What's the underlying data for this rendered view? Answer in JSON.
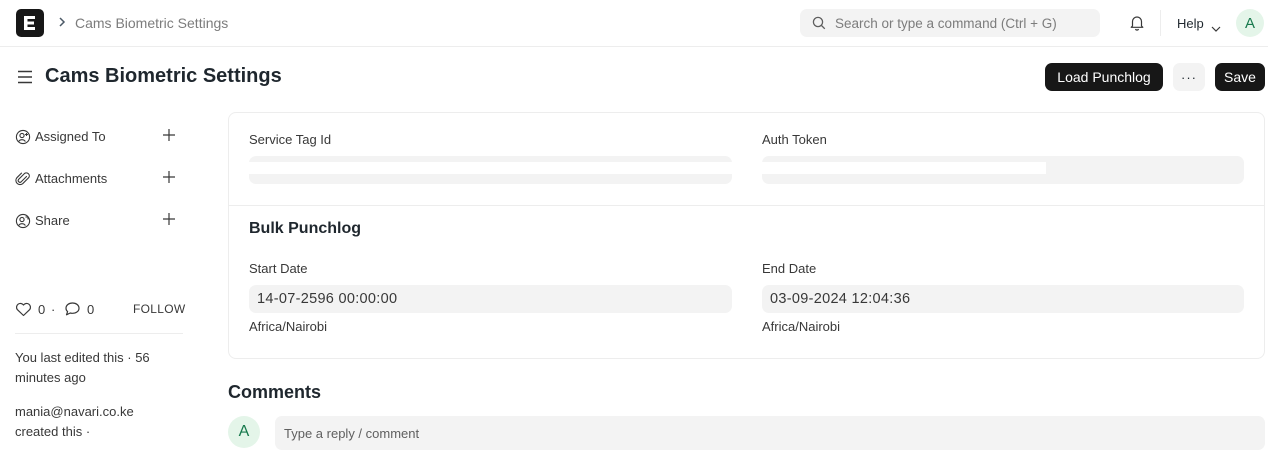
{
  "navbar": {
    "logo_letter": "E",
    "breadcrumb": "Cams Biometric Settings",
    "search_placeholder": "Search or type a command (Ctrl + G)",
    "help_label": "Help",
    "avatar_initial": "A"
  },
  "page": {
    "title": "Cams Biometric Settings",
    "load_button": "Load Punchlog",
    "more_button": "···",
    "save_button": "Save"
  },
  "sidebar": {
    "items": [
      {
        "label": "Assigned To",
        "icon": "user-add-icon"
      },
      {
        "label": "Attachments",
        "icon": "paperclip-icon"
      },
      {
        "label": "Share",
        "icon": "share-user-icon"
      }
    ],
    "likes": "0",
    "comments": "0",
    "dot": "·",
    "follow": "FOLLOW",
    "last_edited": "You last edited this · 56 minutes ago",
    "created_by": "mania@navari.co.ke",
    "created_suffix": "created this ·"
  },
  "form": {
    "service_tag_label": "Service Tag Id",
    "service_tag_value": "",
    "auth_token_label": "Auth Token",
    "auth_token_value": "",
    "section_title": "Bulk Punchlog",
    "start_date_label": "Start Date",
    "start_date_value": "14-07-2596 00:00:00",
    "start_tz": "Africa/Nairobi",
    "end_date_label": "End Date",
    "end_date_value": "03-09-2024 12:04:36",
    "end_tz": "Africa/Nairobi"
  },
  "comments": {
    "heading": "Comments",
    "avatar_initial": "A",
    "placeholder": "Type a reply / comment"
  },
  "colors": {
    "accent_dark": "#171717",
    "field_bg": "#f3f3f3",
    "avatar_bg": "#e4f5e9",
    "avatar_fg": "#16794c"
  }
}
